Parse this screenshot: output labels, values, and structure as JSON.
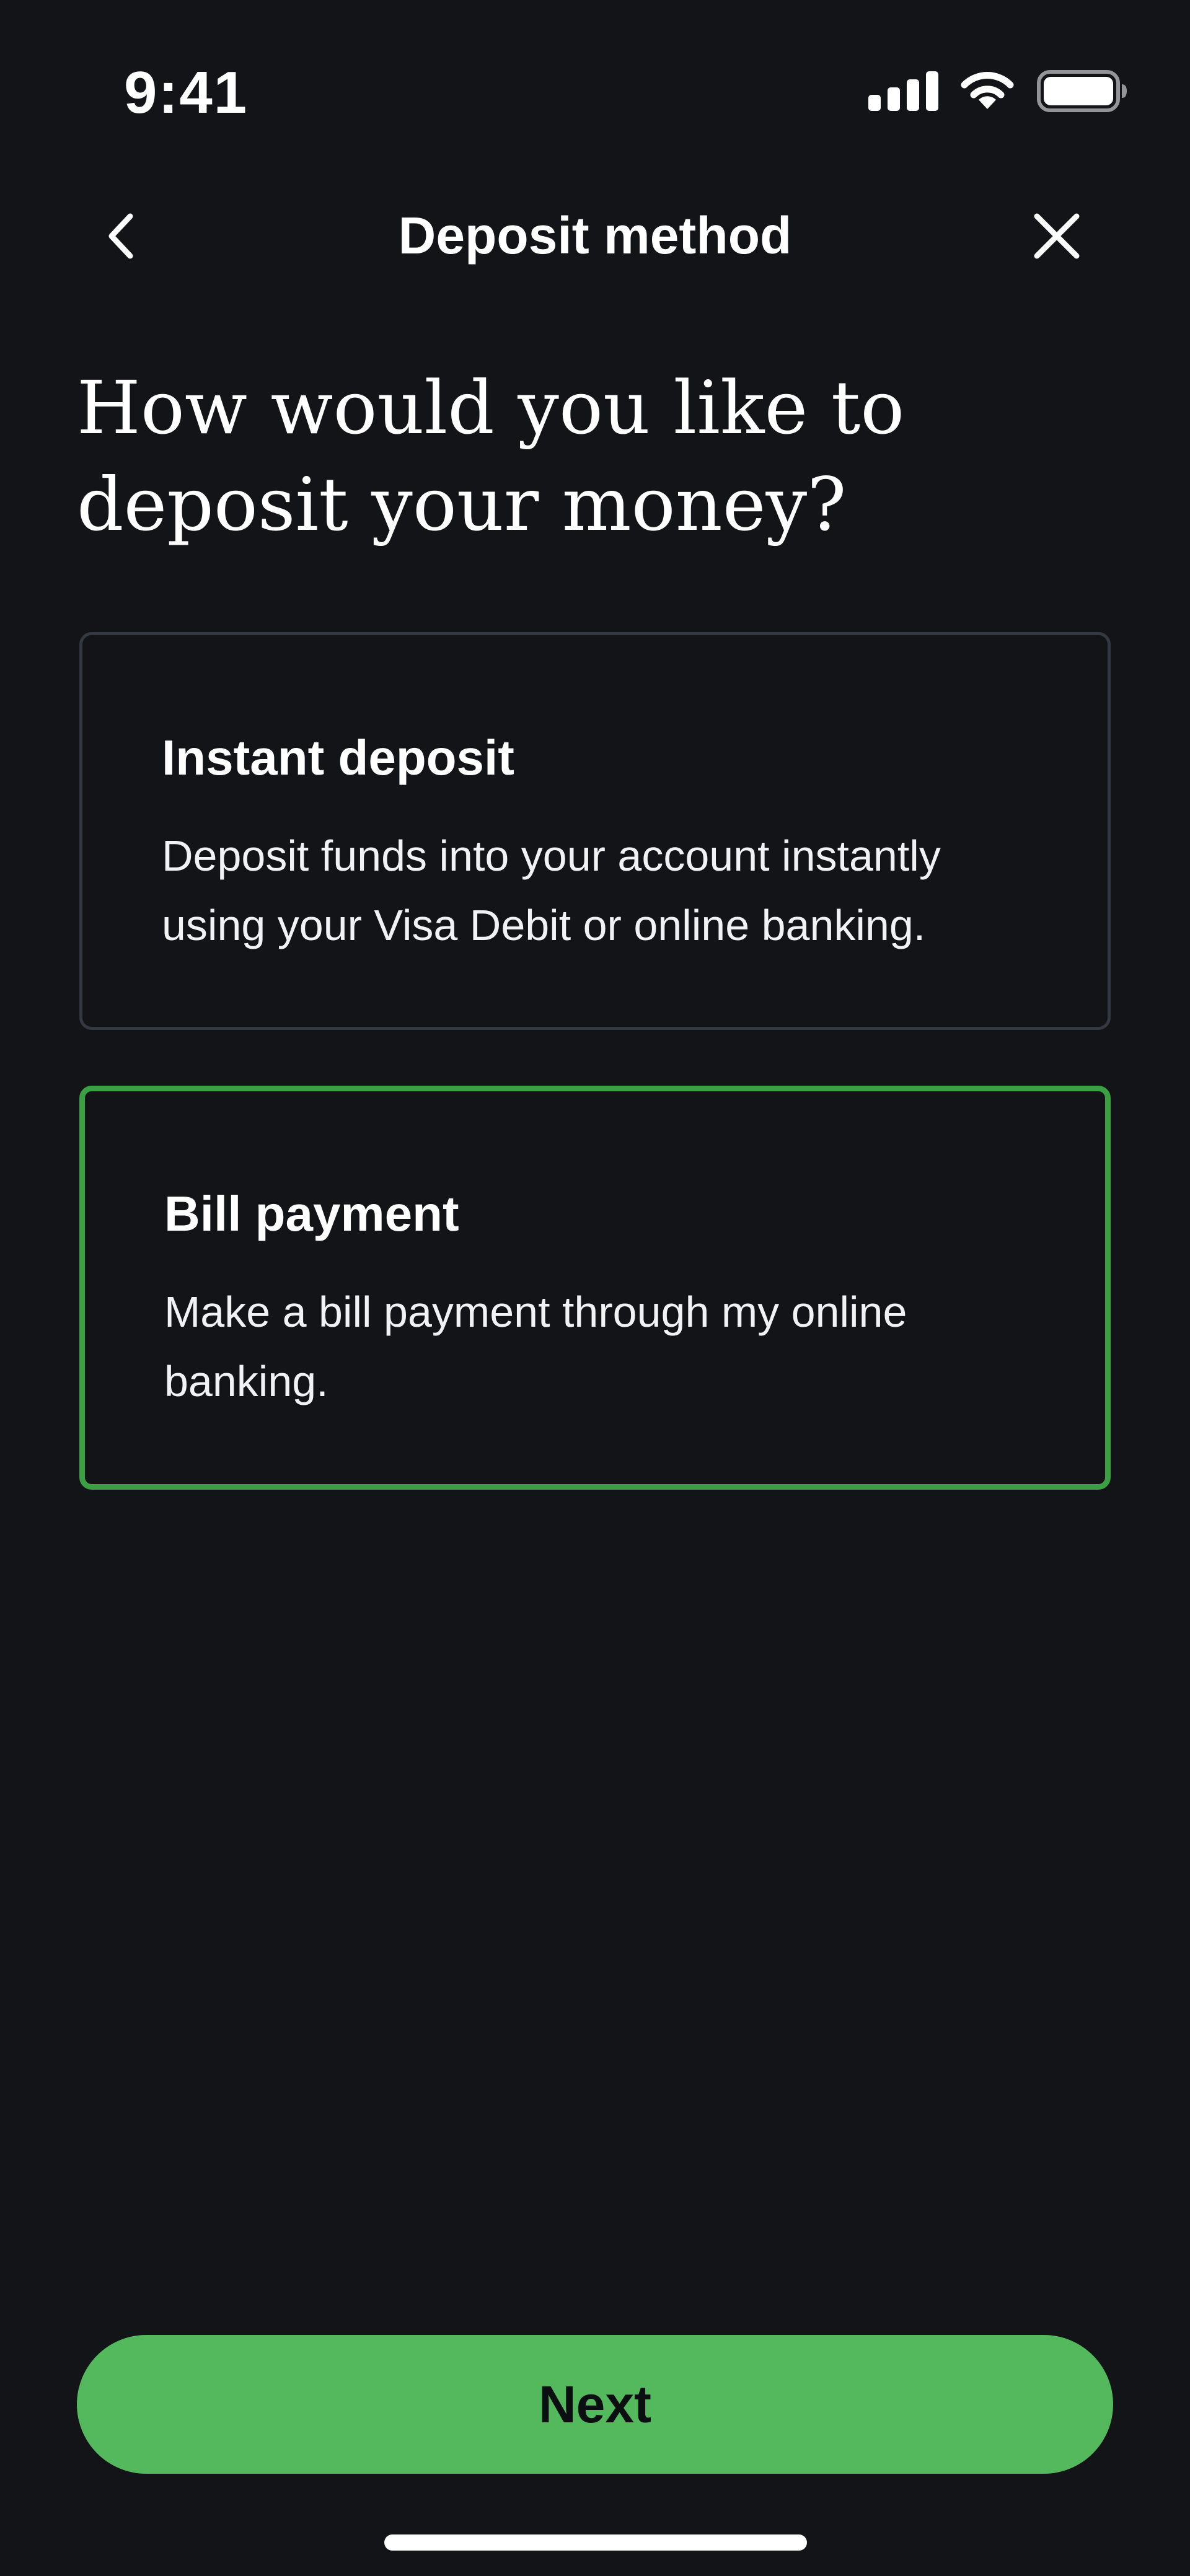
{
  "status_bar": {
    "time": "9:41",
    "icons": [
      "signal-icon",
      "wifi-icon",
      "battery-icon"
    ]
  },
  "nav": {
    "title": "Deposit method",
    "back_icon": "chevron-left-icon",
    "close_icon": "close-icon"
  },
  "heading": "How would you like to deposit your money?",
  "options": [
    {
      "title": "Instant deposit",
      "description": "Deposit funds into your account instantly using your Visa Debit or online banking.",
      "selected": false
    },
    {
      "title": "Bill payment",
      "description": "Make a bill payment through my online banking.",
      "selected": true
    }
  ],
  "next_button": "Next",
  "colors": {
    "background": "#121418",
    "accent": "#54b95d",
    "selected_border": "#3aa043",
    "card_border": "#343941",
    "text": "#ffffff"
  }
}
